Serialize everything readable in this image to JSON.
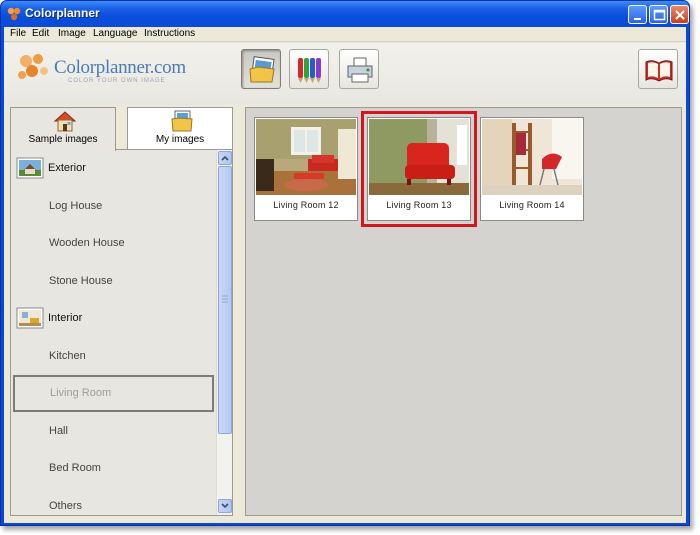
{
  "window": {
    "title": "Colorplanner"
  },
  "menu": [
    "File",
    "Edit",
    "Image",
    "Language",
    "Instructions"
  ],
  "brand": {
    "name": "Colorplanner.com",
    "tagline": "COLOR YOUR OWN IMAGE"
  },
  "toolbar": {
    "buttons": [
      {
        "icon": "open-images-icon",
        "pressed": true
      },
      {
        "icon": "color-pencils-icon",
        "pressed": false
      },
      {
        "icon": "printer-icon",
        "pressed": false
      },
      {
        "icon": "book-icon",
        "pressed": false
      }
    ]
  },
  "tabs": [
    {
      "label": "Sample images",
      "active": true,
      "icon": "house-icon"
    },
    {
      "label": "My images",
      "active": false,
      "icon": "folder-image-icon"
    }
  ],
  "categories": [
    {
      "label": "Exterior",
      "type": "header",
      "icon": "house-photo-icon"
    },
    {
      "label": "Log House",
      "type": "item"
    },
    {
      "label": "Wooden House",
      "type": "item"
    },
    {
      "label": "Stone House",
      "type": "item"
    },
    {
      "label": "Interior",
      "type": "header",
      "icon": "room-photo-icon"
    },
    {
      "label": "Kitchen",
      "type": "item"
    },
    {
      "label": "Living Room",
      "type": "item",
      "selected": true
    },
    {
      "label": "Hall",
      "type": "item"
    },
    {
      "label": "Bed Room",
      "type": "item"
    },
    {
      "label": "Others",
      "type": "item"
    }
  ],
  "thumbnails": [
    {
      "label": "Living Room 12",
      "selected": false
    },
    {
      "label": "Living Room 13",
      "selected": true
    },
    {
      "label": "Living Room 14",
      "selected": false
    }
  ],
  "colors": {
    "selection": "#d0161e",
    "title_bar": "#0a4ede",
    "panel": "#ece9d8"
  }
}
